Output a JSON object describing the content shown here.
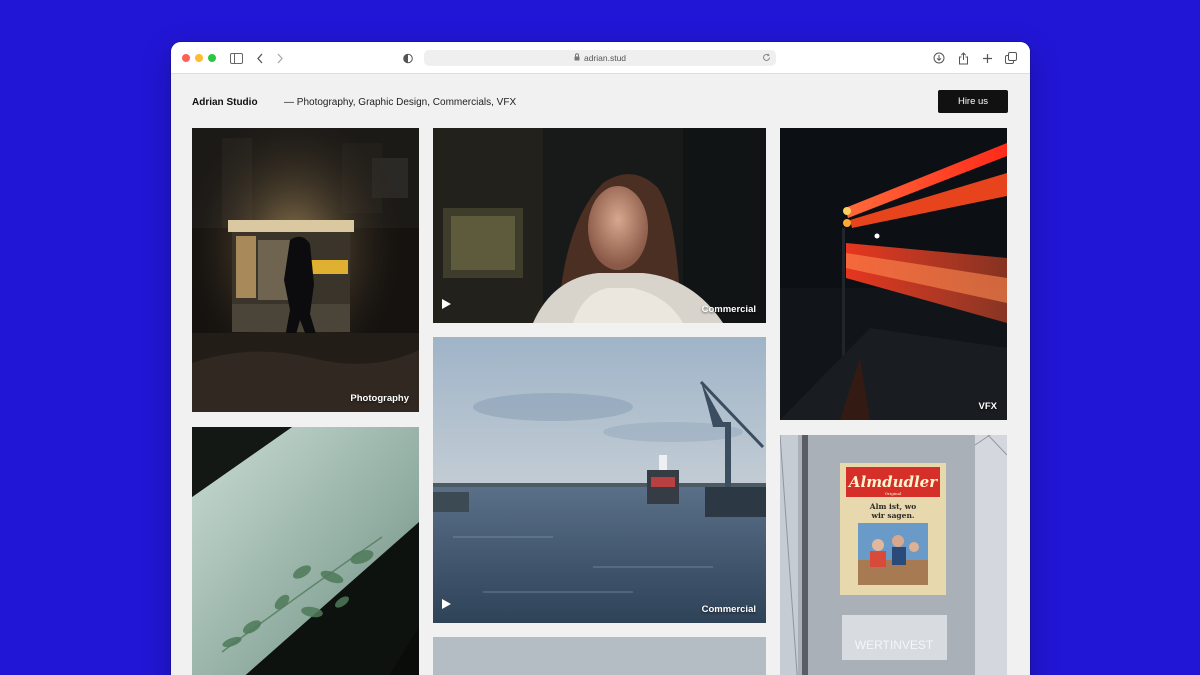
{
  "browser": {
    "url": "adrian.stud",
    "icons": [
      "sidebar-icon",
      "back-icon",
      "forward-icon",
      "privacy-shield-icon",
      "lock-icon",
      "reload-icon",
      "download-icon",
      "share-icon",
      "new-tab-icon",
      "tabs-overview-icon"
    ]
  },
  "header": {
    "brand": "Adrian Studio",
    "tagline": "— Photography, Graphic Design, Commercials, VFX",
    "cta_label": "Hire us"
  },
  "gallery": {
    "tiles": [
      {
        "label": "Photography",
        "has_play": false
      },
      {
        "label": "Commercial",
        "has_play": true
      },
      {
        "label": "VFX",
        "has_play": false
      },
      {
        "label": "",
        "has_play": false
      },
      {
        "label": "Commercial",
        "has_play": true
      },
      {
        "label": "",
        "has_play": false
      },
      {
        "label": "",
        "has_play": false
      }
    ],
    "billboard": {
      "brand": "Almdudler",
      "sub": "Original",
      "slogan_line1": "Alm ist, wo",
      "slogan_line2": "wir sagen.",
      "building_sign": "WERTINVEST"
    }
  },
  "colors": {
    "background": "#2216d6",
    "button": "#111111",
    "page": "#f1f1f1"
  }
}
